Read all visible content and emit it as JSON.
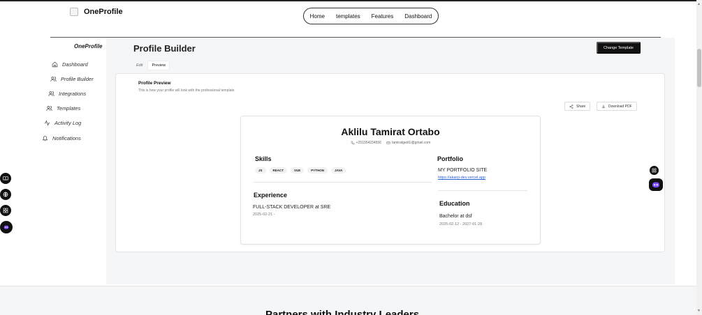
{
  "brand": {
    "name": "OneProfile"
  },
  "topnav": {
    "items": [
      "Home",
      "templates",
      "Features",
      "Dashboard"
    ]
  },
  "sidebar": {
    "title": "OneProfile",
    "items": [
      {
        "label": "Dashboard",
        "icon": "home-icon"
      },
      {
        "label": "Profile Builder",
        "icon": "users-icon"
      },
      {
        "label": "Integrations",
        "icon": "users-icon"
      },
      {
        "label": "Templates",
        "icon": "users-icon"
      },
      {
        "label": "Activity Log",
        "icon": "activity-icon"
      },
      {
        "label": "Notifications",
        "icon": "bell-icon"
      }
    ]
  },
  "main": {
    "title": "Profile Builder",
    "change_template_label": "Change Template",
    "tabs": [
      {
        "label": "Edit",
        "active": false
      },
      {
        "label": "Preview",
        "active": true
      }
    ],
    "preview": {
      "title": "Profile Preview",
      "subtitle": "This is how your profile will look with the professional template",
      "share_label": "Share",
      "download_label": "Download PDF"
    }
  },
  "resume": {
    "name": "Aklilu Tamirat Ortabo",
    "phone": "+251954234556",
    "email": "tamiratgedi1@gmail.com",
    "skills_title": "Skills",
    "skills": [
      "JS",
      "REACT",
      "VUE",
      "PYTHON",
      "JAVA"
    ],
    "portfolio_title": "Portfolio",
    "portfolio_name": "MY PORTFOLIO SITE",
    "portfolio_url": "https://akanji-dev.vercel.app",
    "experience_title": "Experience",
    "experience_role": "FULL-STACK DEVELOPER at SRE",
    "experience_dates": "2025-02-21 -",
    "education_title": "Education",
    "education_degree": "Bachelor at dsf",
    "education_dates": "2025-02-12 - 2027-01-28"
  },
  "bottom": {
    "heading": "Partners with Industry Leaders"
  },
  "colors": {
    "accent": "#111111",
    "link": "#2b5fd9",
    "bot": "#7c4dff"
  }
}
